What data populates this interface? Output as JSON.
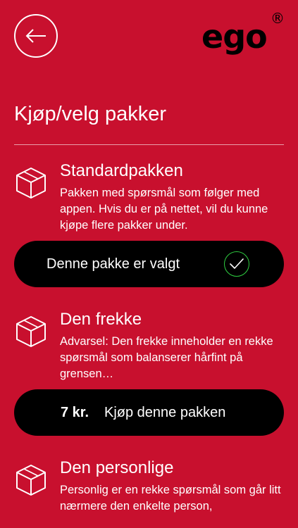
{
  "header": {
    "back_icon": "arrow-left-icon",
    "logo_text": "ego",
    "logo_mark": "®"
  },
  "title": "Kjøp/velg pakker",
  "packages": [
    {
      "name": "Standardpakken",
      "icon": "box-icon",
      "description": "Pakken med spørsmål som følger med appen. Hvis du er på nettet, vil du kunne kjøpe flere pakker under.",
      "action_label": "Denne pakke er valgt",
      "selected": true,
      "check_icon": "checkmark-icon",
      "check_color": "#2ecc40"
    },
    {
      "name": "Den frekke",
      "icon": "box-icon",
      "description": "Advarsel: Den frekke inneholder en rekke spørsmål som balanserer hårfint på grensen…",
      "price": "7 kr.",
      "action_label": "Kjøp denne pakken",
      "selected": false
    },
    {
      "name": "Den personlige",
      "icon": "box-icon",
      "description": "Personlig er en rekke spørsmål som går litt nærmere den enkelte person,"
    }
  ],
  "colors": {
    "background": "#c8102e",
    "button": "#000000",
    "text": "#ffffff",
    "logo": "#000000"
  }
}
